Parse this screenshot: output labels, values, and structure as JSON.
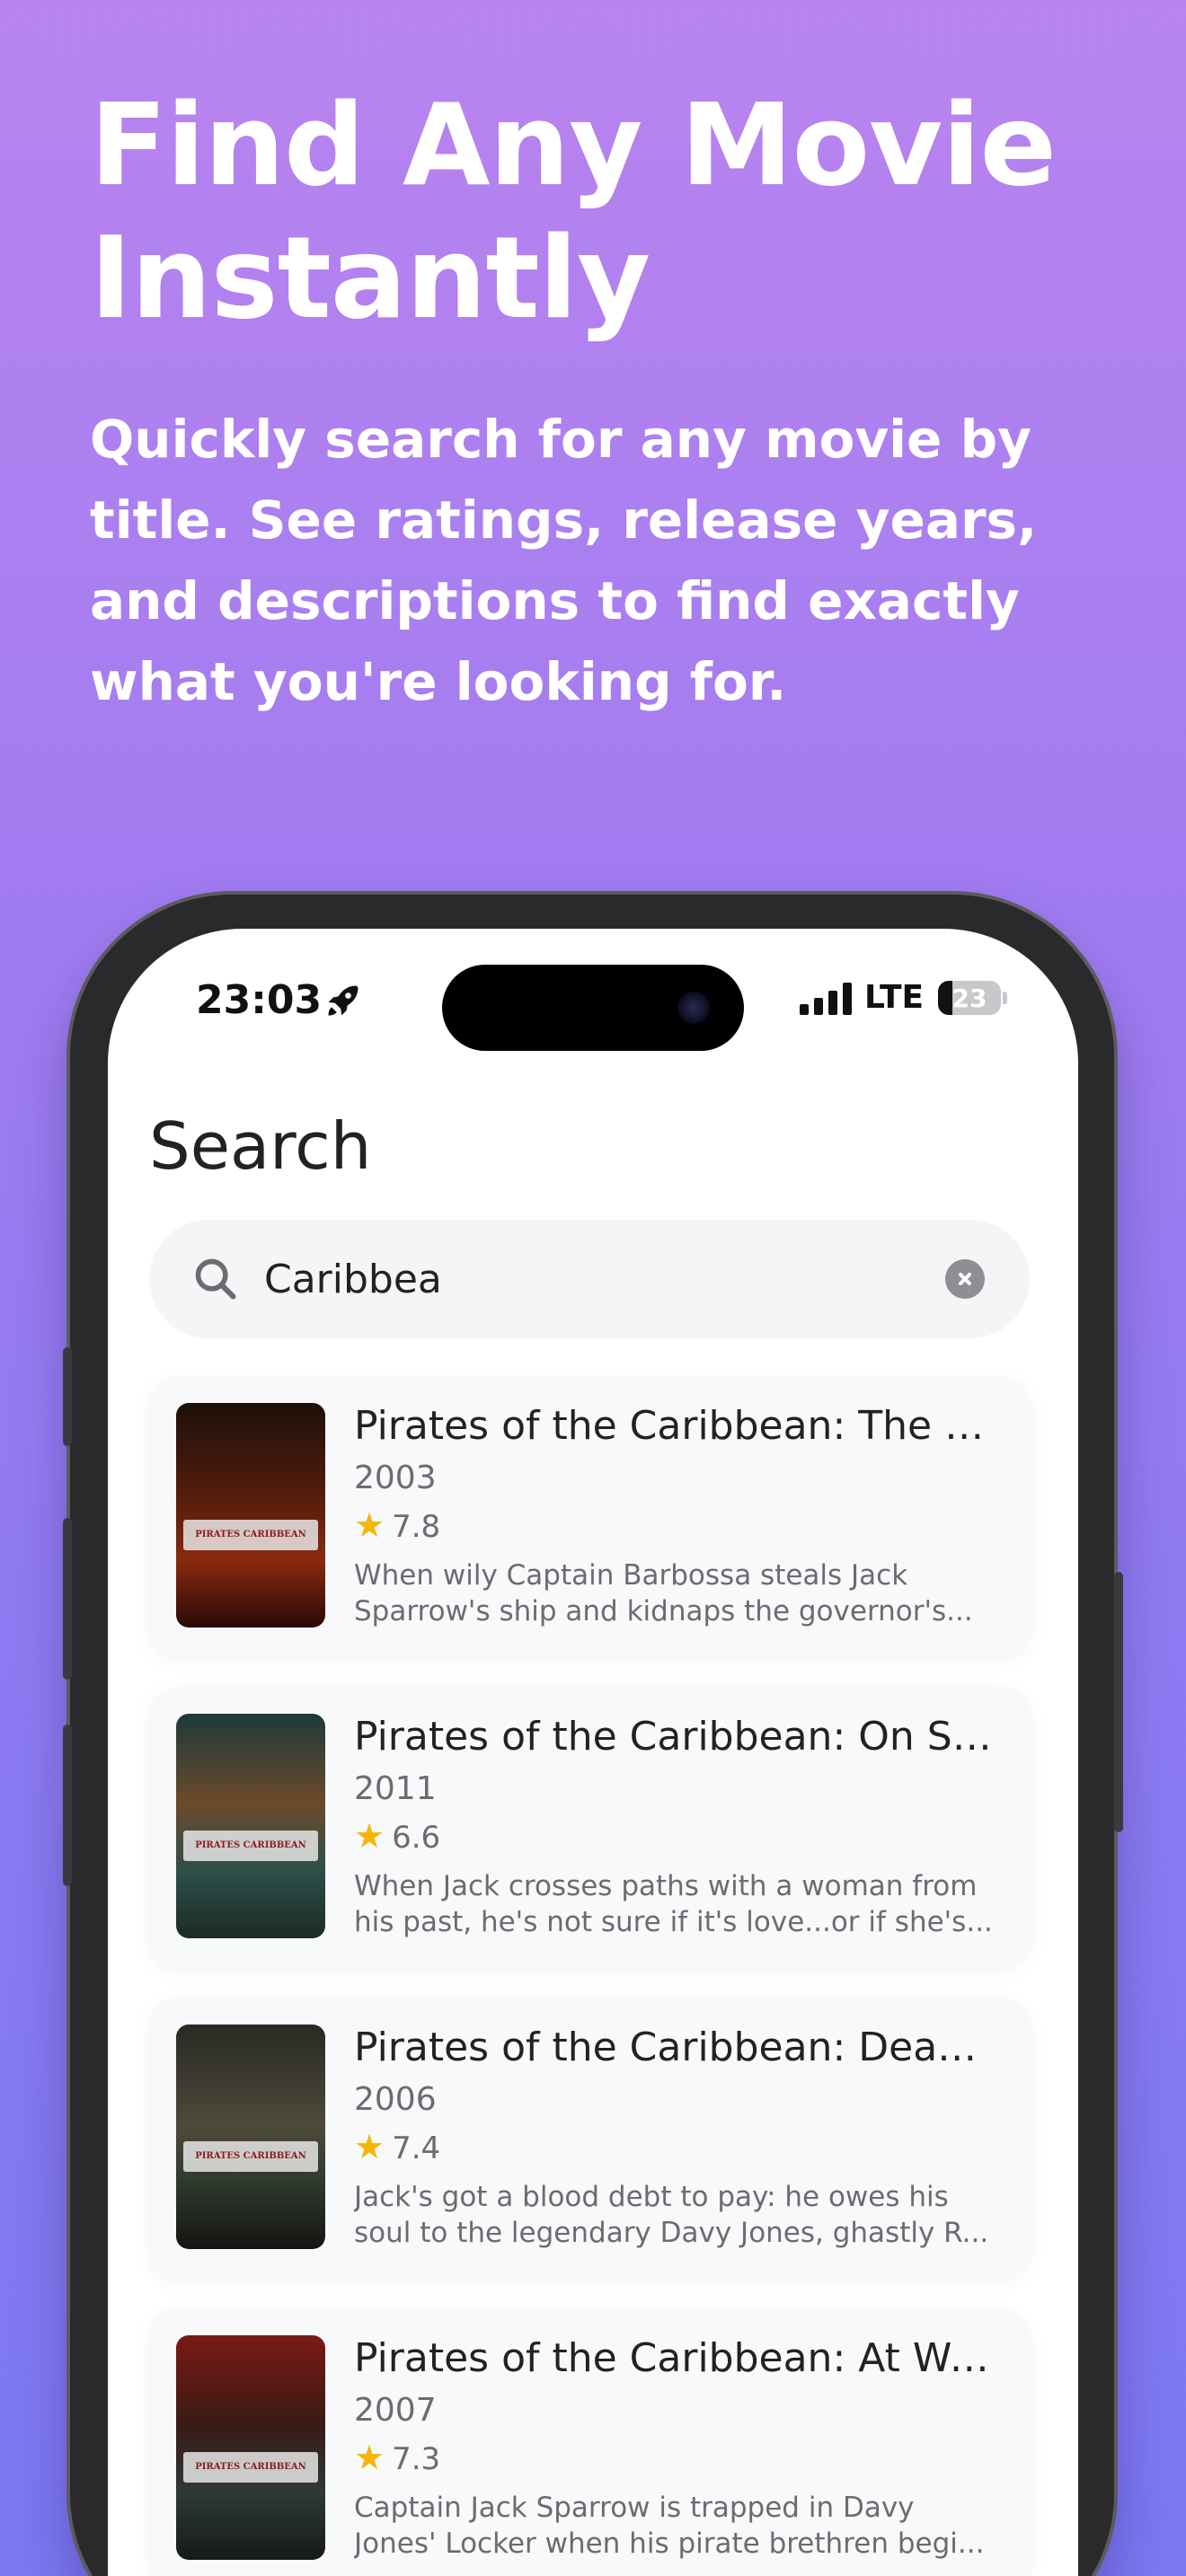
{
  "hero": {
    "title": "Find Any Movie Instantly",
    "subtitle": "Quickly search for any movie by title. See ratings, release years, and descriptions to find exactly what you're looking for."
  },
  "status_bar": {
    "time": "23:03",
    "network": "LTE",
    "battery": "23",
    "battery_level": 0.23
  },
  "page": {
    "title": "Search"
  },
  "search": {
    "value": "Caribbea",
    "placeholder": ""
  },
  "results": [
    {
      "title": "Pirates of the Caribbean: The Cur...",
      "year": "2003",
      "rating": "7.8",
      "description": "When wily Captain Barbossa steals Jack Sparrow's ship and kidnaps the governor's..."
    },
    {
      "title": "Pirates of the Caribbean: On Stran...",
      "year": "2011",
      "rating": "6.6",
      "description": "When Jack crosses paths with a woman from his past, he's not sure if it's love...or if she's..."
    },
    {
      "title": "Pirates of the Caribbean: Dead Ma...",
      "year": "2006",
      "rating": "7.4",
      "description": "Jack's got a blood debt to pay: he owes his soul to the legendary Davy Jones, ghastly R..."
    },
    {
      "title": "Pirates of the Caribbean: At World...",
      "year": "2007",
      "rating": "7.3",
      "description": "Captain Jack Sparrow is trapped in Davy Jones' Locker when his pirate brethren begi..."
    }
  ],
  "icons": {
    "rating": "star-icon",
    "search": "search-icon",
    "clear": "clear-icon"
  },
  "colors": {
    "star": "#f5b50a",
    "accent_gradient_top": "#b984ef",
    "accent_gradient_bottom": "#7b78f3"
  }
}
